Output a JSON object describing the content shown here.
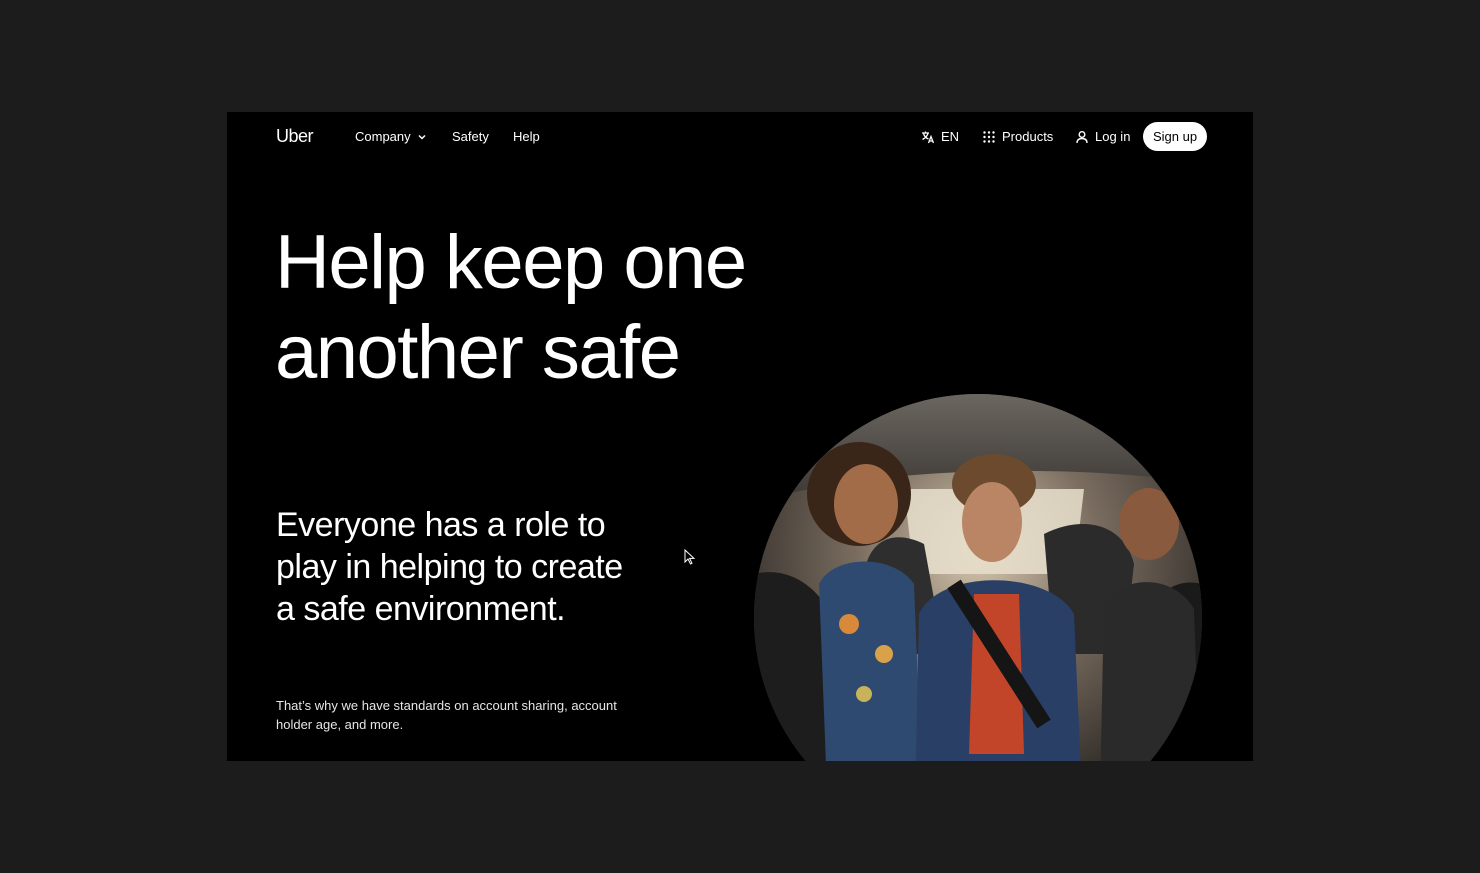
{
  "nav": {
    "logo": "Uber",
    "company_label": "Company",
    "safety_label": "Safety",
    "help_label": "Help",
    "language_label": "EN",
    "products_label": "Products",
    "login_label": "Log in",
    "signup_label": "Sign up"
  },
  "hero": {
    "title_line1": "Help keep one",
    "title_line2": "another safe",
    "subhead": "Everyone has a role to play in helping to create a safe environment.",
    "body": "That’s why we have standards on account sharing, account holder age, and more."
  },
  "colors": {
    "page_bg": "#1c1c1c",
    "frame_bg": "#000000",
    "text": "#ffffff",
    "button_bg": "#ffffff",
    "button_text": "#000000"
  }
}
